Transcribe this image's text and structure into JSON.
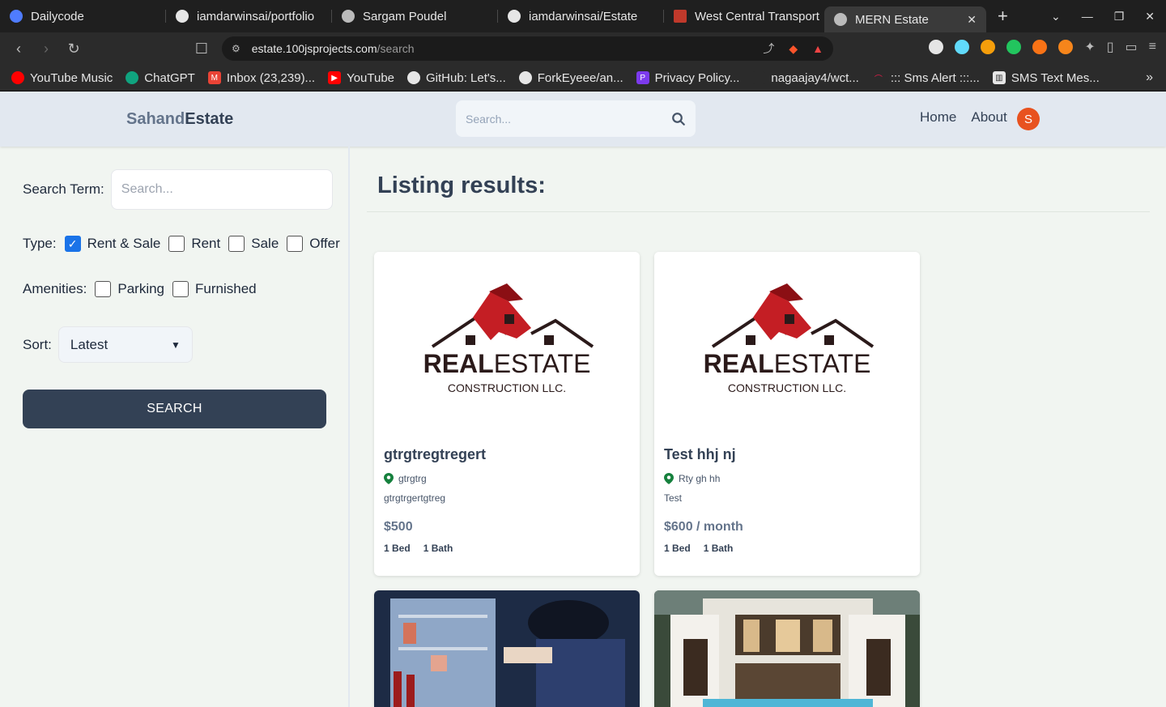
{
  "browser": {
    "tabs": [
      {
        "title": "Dailycode",
        "icon": "dailycode-icon"
      },
      {
        "title": "iamdarwinsai/portfolio",
        "icon": "github-icon"
      },
      {
        "title": "Sargam Poudel",
        "icon": "globe-icon"
      },
      {
        "title": "iamdarwinsai/Estate",
        "icon": "github-icon"
      },
      {
        "title": "West Central Transport",
        "icon": "page-icon"
      },
      {
        "title": "MERN Estate",
        "icon": "globe-icon"
      }
    ],
    "url_host": "estate.100jsprojects.com",
    "url_path": "/search",
    "bookmarks": [
      {
        "label": "YouTube Music",
        "color": "#ff0000"
      },
      {
        "label": "ChatGPT",
        "color": "#10a37f"
      },
      {
        "label": "Inbox (23,239)...",
        "color": "#ea4335"
      },
      {
        "label": "YouTube",
        "color": "#ff0000"
      },
      {
        "label": "GitHub: Let's...",
        "color": "#ffffff"
      },
      {
        "label": "ForkEyeee/an...",
        "color": "#ffffff"
      },
      {
        "label": "Privacy Policy...",
        "color": "#7c3aed"
      },
      {
        "label": "nagaajay4/wct...",
        "color": "#2b2b2b"
      },
      {
        "label": "::: Sms Alert :::...",
        "color": "#e11d48"
      },
      {
        "label": "SMS Text Mes...",
        "color": "#ffffff"
      }
    ]
  },
  "header": {
    "logo_part1": "Sahand",
    "logo_part2": "Estate",
    "search_placeholder": "Search...",
    "nav_home": "Home",
    "nav_about": "About",
    "avatar_letter": "S"
  },
  "sidebar": {
    "search_term_label": "Search Term:",
    "search_term_placeholder": "Search...",
    "type_label": "Type:",
    "type_options": [
      {
        "label": "Rent & Sale",
        "checked": true
      },
      {
        "label": "Rent",
        "checked": false
      },
      {
        "label": "Sale",
        "checked": false
      },
      {
        "label": "Offer",
        "checked": false
      }
    ],
    "amenities_label": "Amenities:",
    "amenities_options": [
      {
        "label": "Parking",
        "checked": false
      },
      {
        "label": "Furnished",
        "checked": false
      }
    ],
    "sort_label": "Sort:",
    "sort_value": "Latest",
    "search_button": "SEARCH"
  },
  "main": {
    "title": "Listing results:",
    "listings": [
      {
        "name": "gtrgtregtregert",
        "location": "gtrgtrg",
        "description": "gtrgtrgertgtreg",
        "price": "$500",
        "beds": "1 Bed",
        "baths": "1 Bath",
        "logo_line1a": "REAL",
        "logo_line1b": "ESTATE",
        "logo_line2": "CONSTRUCTION LLC."
      },
      {
        "name": "Test hhj nj",
        "location": "Rty gh hh",
        "description": "Test",
        "price": "$600 / month",
        "beds": "1 Bed",
        "baths": "1 Bath",
        "logo_line1a": "REAL",
        "logo_line1b": "ESTATE",
        "logo_line2": "CONSTRUCTION LLC."
      }
    ]
  },
  "colors": {
    "accent": "#334155",
    "pin": "#15803d",
    "avatar": "#e8521f"
  }
}
